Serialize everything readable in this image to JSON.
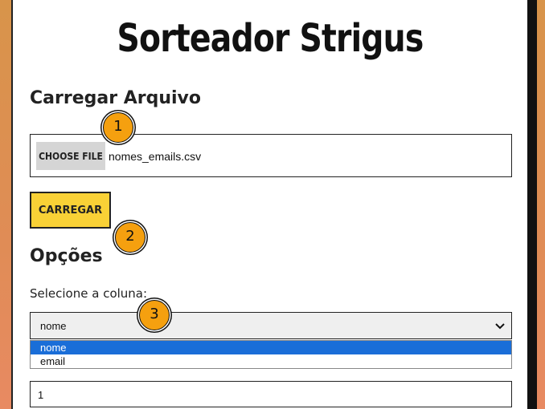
{
  "app": {
    "title": "Sorteador Strigus"
  },
  "upload": {
    "heading": "Carregar Arquivo",
    "choose_label": "CHOOSE FILE",
    "file_name": "nomes_emails.csv",
    "load_label": "CARREGAR"
  },
  "options": {
    "heading": "Opções",
    "column_label": "Selecione a coluna:",
    "selected_column": "nome",
    "column_options": [
      "nome",
      "email"
    ],
    "quantity_value": "1"
  },
  "markers": [
    "1",
    "2",
    "3"
  ],
  "colors": {
    "accent_button": "#f9d136",
    "marker": "#f5a00f",
    "selection": "#1a6ed8"
  }
}
